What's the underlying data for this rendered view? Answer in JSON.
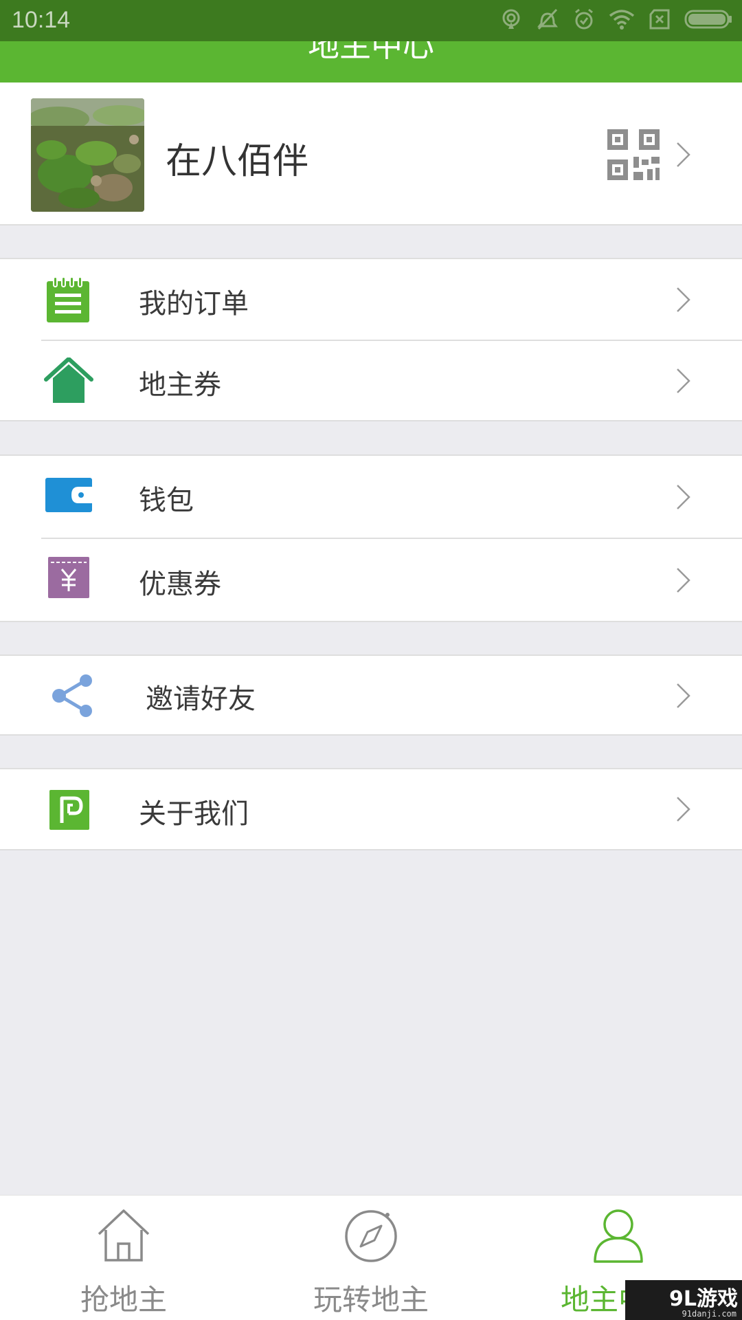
{
  "status_bar": {
    "time": "10:14",
    "icons": [
      "hotspot-icon",
      "vibrate-off-icon",
      "alarm-icon",
      "wifi-icon",
      "no-sim-icon",
      "battery-icon"
    ]
  },
  "header": {
    "title": "地主中心"
  },
  "profile": {
    "name": "在八佰伴"
  },
  "menu": {
    "orders": "我的订单",
    "landlord_voucher": "地主券",
    "wallet": "钱包",
    "coupon": "优惠券",
    "invite": "邀请好友",
    "about": "关于我们"
  },
  "tabs": [
    {
      "label": "抢地主",
      "icon": "home-icon",
      "active": false
    },
    {
      "label": "玩转地主",
      "icon": "compass-icon",
      "active": false
    },
    {
      "label": "地主中心",
      "icon": "person-icon",
      "active": true
    }
  ],
  "watermark": {
    "main": "9L游戏",
    "sub": "91danji.com"
  },
  "colors": {
    "status_bar": "#3d7a1f",
    "header": "#5bb632",
    "accent": "#5bb632",
    "wallet_icon": "#1f90d6",
    "coupon_icon": "#9b6ba0",
    "share_icon": "#7aa3dc",
    "voucher_icon": "#2d9e5f"
  }
}
